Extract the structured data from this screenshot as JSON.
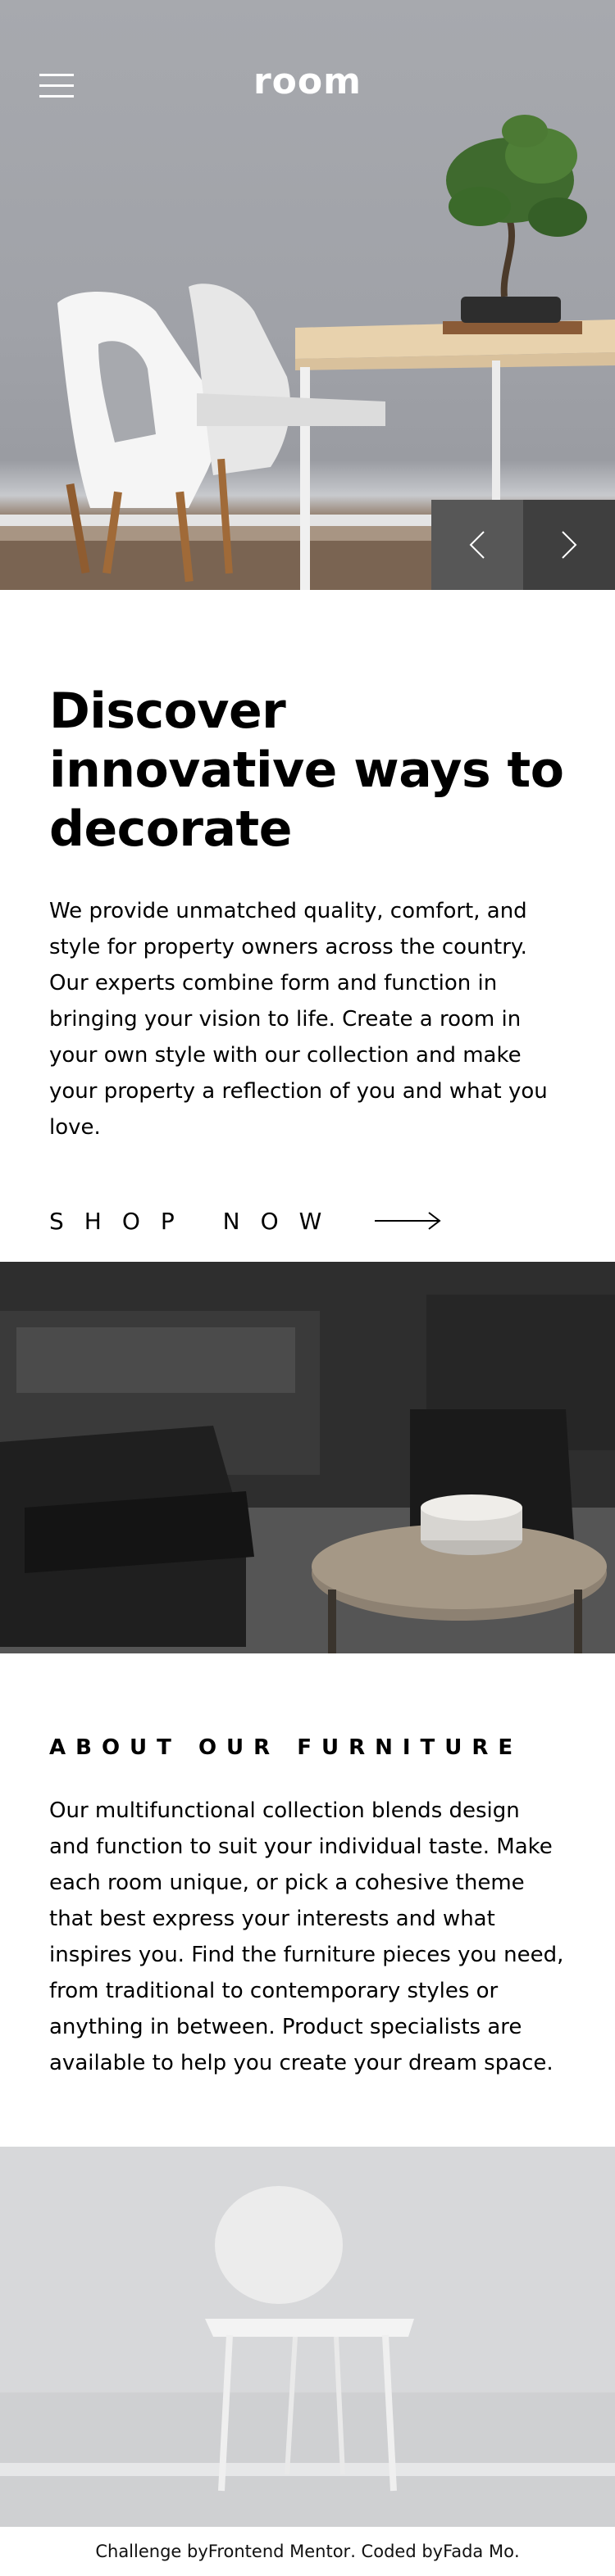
{
  "header": {
    "logo": "room",
    "menu_icon": "hamburger-menu-icon"
  },
  "hero": {
    "prev_icon": "chevron-left-icon",
    "next_icon": "chevron-right-icon"
  },
  "intro": {
    "title": "Discover innovative ways to decorate",
    "body": "We provide unmatched quality, comfort, and style for property owners across the country. Our experts combine form and function in bringing your vision to life. Create a room in your own style with our collection and make your property a reflection of you and what you love.",
    "cta_label": "SHOP NOW",
    "cta_icon": "arrow-right-icon"
  },
  "about": {
    "title": "ABOUT OUR FURNITURE",
    "body": "Our multifunctional collection blends design and function to suit your individual taste. Make each room unique, or pick a cohesive theme that best express your interests and what inspires you. Find the furniture pieces you need, from traditional to contemporary styles or anything in between. Product specialists are available to help you create your dream space."
  },
  "footer": {
    "prefix": "Challenge by ",
    "link1": "Frontend Mentor",
    "middle": " . Coded by ",
    "link2": "Fada Mo",
    "suffix": "."
  }
}
